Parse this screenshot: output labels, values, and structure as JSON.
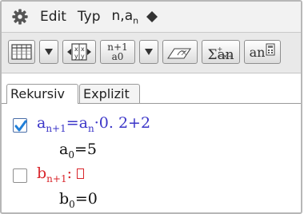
{
  "menubar": {
    "settings_icon": "gear-icon",
    "edit_label": "Edit",
    "type_label": "Typ",
    "nan_main": "n,a",
    "nan_sub": "n",
    "more_icon": "diamond-icon"
  },
  "toolbar": {
    "table_icon": "table-icon",
    "dropdown_icon": "triangle-down-icon",
    "table_settings_icon": "table-settings-icon",
    "n_plus_1_label": "n+1",
    "a0_label": "a0",
    "graph_icon": "graph-icon",
    "sigma_small": "+−×÷",
    "sigma_label": "Σan",
    "an_label": "an"
  },
  "tabs": [
    {
      "label": "Rekursiv",
      "active": true
    },
    {
      "label": "Explizit",
      "active": false
    }
  ],
  "rows": {
    "a": {
      "checked": true,
      "var": "a",
      "sub": "n+1",
      "eq": "=",
      "rhs_var": "a",
      "rhs_sub": "n",
      "rhs_rest": "·0. 2+2",
      "init_var": "a",
      "init_sub": "0",
      "init_eq": "=5"
    },
    "b": {
      "checked": false,
      "var": "b",
      "sub": "n+1",
      "colon": ":",
      "init_var": "b",
      "init_sub": "0",
      "init_eq": "=0"
    }
  },
  "colors": {
    "blue_formula": "#3b35c8",
    "red_formula": "#d9252b",
    "checkbox_tick": "#1f7fd9"
  }
}
